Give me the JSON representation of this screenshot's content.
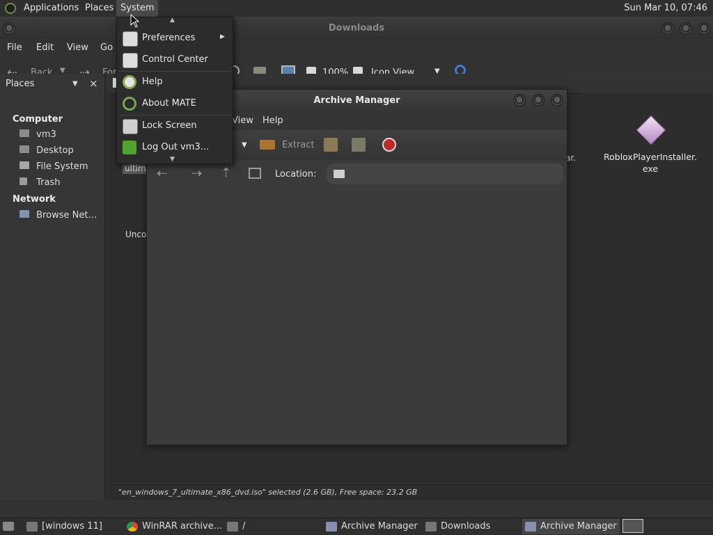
{
  "top_panel": {
    "applications": "Applications",
    "places": "Places",
    "system": "System",
    "clock": "Sun Mar 10, 07:46"
  },
  "file_manager": {
    "title": "Downloads",
    "menu": [
      "File",
      "Edit",
      "View",
      "Go"
    ],
    "toolbar": {
      "back": "Back",
      "forward": "For",
      "zoom": "100%",
      "view_mode": "Icon View"
    },
    "sidebar": {
      "header": "Places",
      "computer_section": "Computer",
      "computer_items": [
        "vm3",
        "Desktop",
        "File System",
        "Trash"
      ],
      "network_section": "Network",
      "network_items": [
        "Browse Net…"
      ]
    },
    "files": {
      "roblox_name_line1": "RobloxPlayerInstaller.",
      "roblox_name_line2": "exe",
      "partial_ultim": "ultim",
      "partial_unco": "Unco",
      "partial_ar": "ar."
    },
    "status": "\"en_windows_7_ultimate_x86_dvd.iso\" selected (2.6 GB), Free space: 23.2 GB"
  },
  "archive_manager": {
    "title": "Archive Manager",
    "menu": [
      "View",
      "Help"
    ],
    "toolbar": {
      "extract": "Extract"
    },
    "location_label": "Location:"
  },
  "system_menu": {
    "items": [
      {
        "label": "Preferences",
        "icon": "preferences-icon",
        "has_submenu": true
      },
      {
        "label": "Control Center",
        "icon": "control-center-icon"
      },
      {
        "label": "Help",
        "icon": "help-icon"
      },
      {
        "label": "About MATE",
        "icon": "about-mate-icon"
      },
      {
        "label": "Lock Screen",
        "icon": "lock-screen-icon"
      },
      {
        "label": "Log Out vm3...",
        "icon": "log-out-icon"
      }
    ]
  },
  "taskbar": {
    "tasks": [
      "[windows 11]",
      "WinRAR archive...",
      "/",
      "Archive Manager",
      "Downloads",
      "Archive Manager"
    ]
  },
  "colors": {
    "accent_green": "#7aa55a",
    "menu_bg": "#2c2c2c",
    "panel_bg": "#2f2f2f"
  }
}
